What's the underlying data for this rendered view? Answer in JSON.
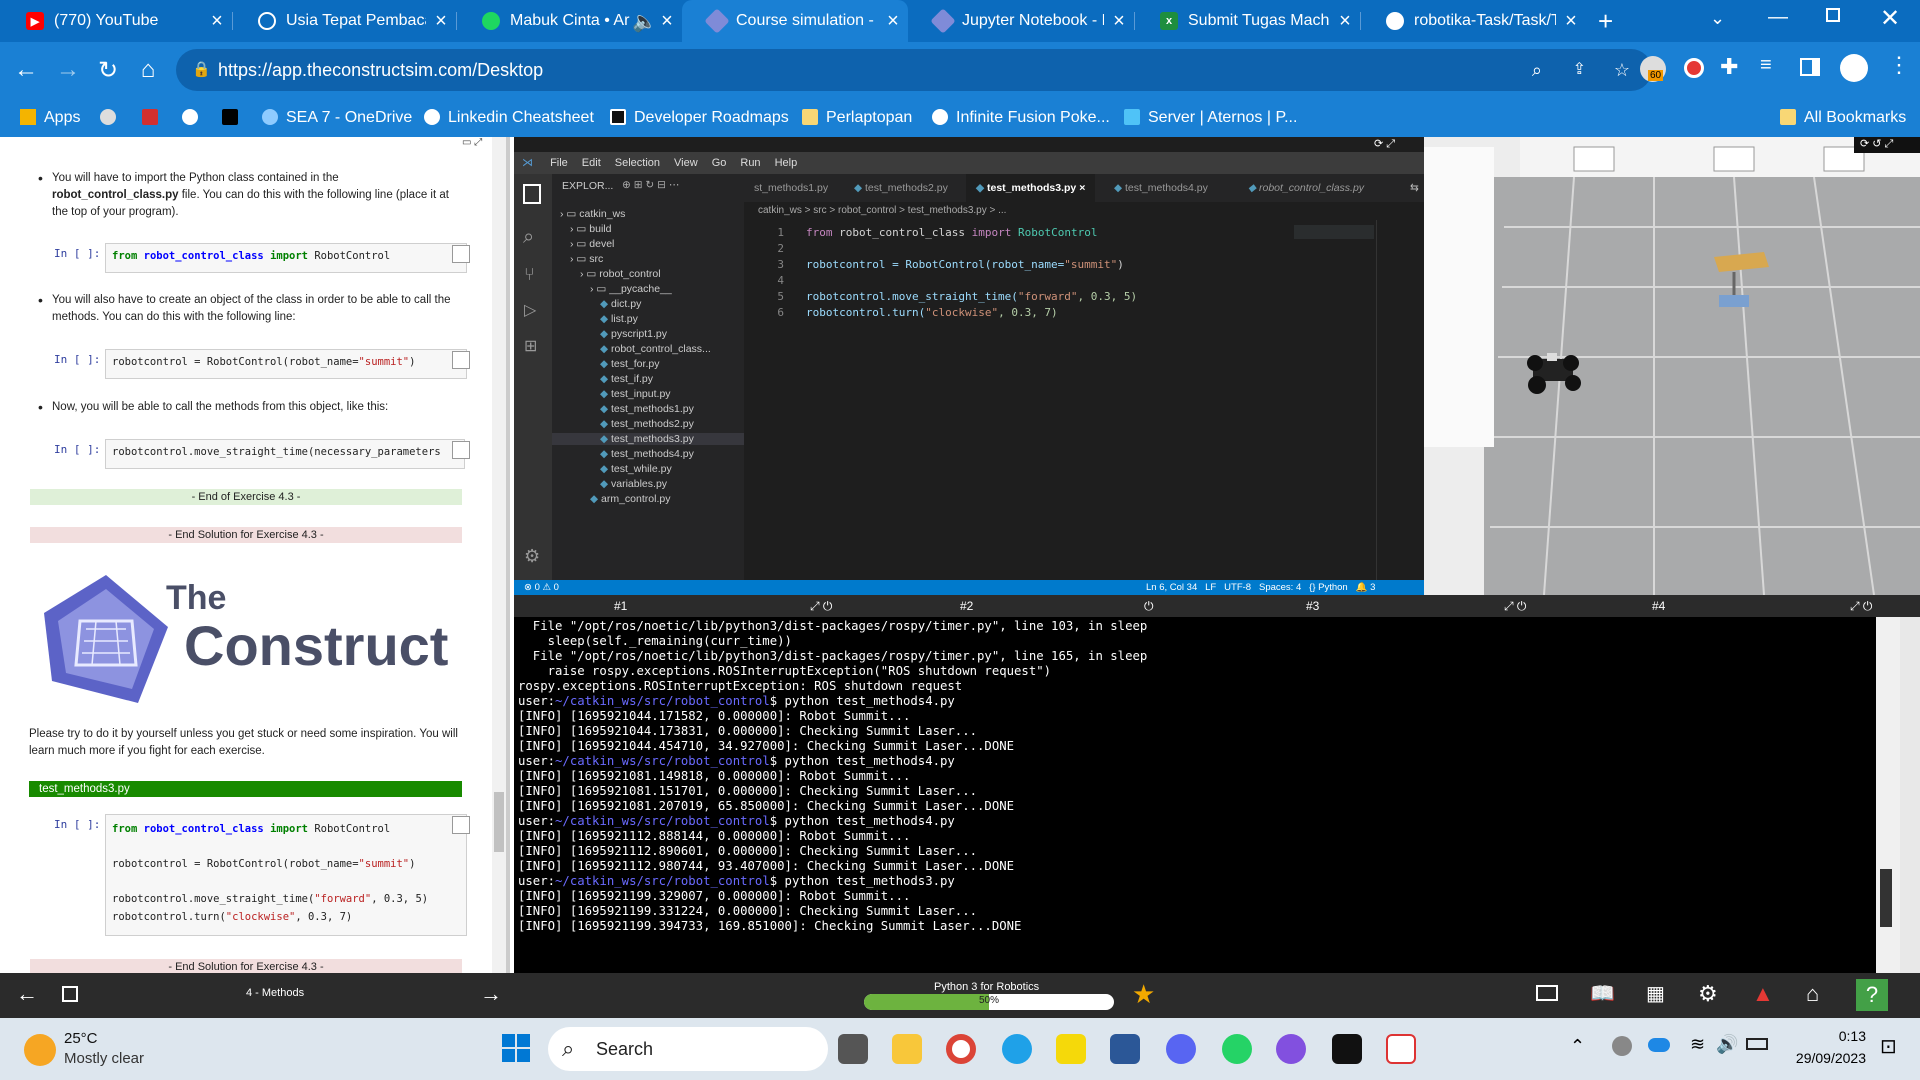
{
  "tabs": [
    {
      "title": "(770) YouTube",
      "icon": "youtube-icon",
      "color": "#ff0000"
    },
    {
      "title": "Usia Tepat Pembaca R",
      "icon": "openai-icon",
      "color": "#ffffff"
    },
    {
      "title": "Mabuk Cinta • Ar",
      "icon": "spotify-icon",
      "color": "#1ed760"
    },
    {
      "title": "Course simulation - P",
      "icon": "theconstruct-icon",
      "color": "#7f8bd8"
    },
    {
      "title": "Jupyter Notebook - P",
      "icon": "theconstruct-icon",
      "color": "#7f8bd8"
    },
    {
      "title": "Submit Tugas Machin",
      "icon": "sheets-icon",
      "color": "#1e8e3e"
    },
    {
      "title": "robotika-Task/Task/Ta",
      "icon": "github-icon",
      "color": "#ffffff"
    }
  ],
  "address": {
    "url": "https://app.theconstructsim.com/Desktop",
    "badge": "60"
  },
  "bookmarks": [
    "Apps",
    "SEA 7 - OneDrive",
    "Linkedin Cheatsheet",
    "Developer Roadmaps",
    "Perlaptopan",
    "Infinite Fusion Poke...",
    "Server | Aternos | P...",
    "All Bookmarks"
  ],
  "notebook": {
    "bullet1_a": "You will have to import the Python class contained in the",
    "bullet1_b": "robot_control_class.py",
    "bullet1_c": " file. You can do this with the following line (place it at the top of your program).",
    "prompt": "In [ ]:",
    "code1_from": "from",
    "code1_mod": "robot_control_class",
    "code1_import": "import",
    "code1_cls": "RobotControl",
    "bullet2": "You will also have to create an object of the class in order to be able to call the methods. You can do this with the following line:",
    "code2_a": "robotcontrol = RobotControl(robot_name=",
    "code2_str": "\"summit\"",
    "code2_b": ")",
    "bullet3": "Now, you will be able to call the methods from this object, like this:",
    "code3": "robotcontrol.move_straight_time(necessary_parameters",
    "end_ex": "- End of Exercise 4.3 -",
    "end_sol": "- End Solution for Exercise 4.3 -",
    "logo_the": "The",
    "logo_construct": "Construct",
    "tip": "Please try to do it by yourself unless you get stuck or need some inspiration. You will learn much more if you fight for each exercise.",
    "file_label": "test_methods3.py",
    "code4_l3a": "robotcontrol.move_straight_time(",
    "code4_l3s": "\"forward\"",
    "code4_l3b": ", 0.3, 5)",
    "code4_l4a": "robotcontrol.turn(",
    "code4_l4s": "\"clockwise\"",
    "code4_l4b": ", 0.3, 7)",
    "end_sol2": "- End Solution for Exercise 4.3 -"
  },
  "vscode": {
    "menu": [
      "File",
      "Edit",
      "Selection",
      "View",
      "Go",
      "Run",
      "Help"
    ],
    "explorer_title": "EXPLOR...",
    "tree": [
      "catkin_ws",
      "build",
      "devel",
      "src",
      "robot_control",
      "__pycache__",
      "dict.py",
      "list.py",
      "pyscript1.py",
      "robot_control_class...",
      "test_for.py",
      "test_if.py",
      "test_input.py",
      "test_methods1.py",
      "test_methods2.py",
      "test_methods3.py",
      "test_methods4.py",
      "test_while.py",
      "variables.py",
      "arm_control.py"
    ],
    "editor_tabs": [
      "st_methods1.py",
      "test_methods2.py",
      "test_methods3.py",
      "test_methods4.py",
      "robot_control_class.py"
    ],
    "breadcrumb": "catkin_ws  >  src  >  robot_control  >  test_methods3.py  >  ...",
    "lines": [
      "1",
      "2",
      "3",
      "4",
      "5",
      "6"
    ],
    "status_left": "⊗ 0 ⚠ 0",
    "status_right": "Ln 6, Col 34   LF   UTF-8   Spaces: 4   {} Python   🔔 3"
  },
  "terminal": {
    "tabs": [
      "#1",
      "#2",
      "#3",
      "#4"
    ],
    "lines": [
      "  File \"/opt/ros/noetic/lib/python3/dist-packages/rospy/timer.py\", line 103, in sleep",
      "    sleep(self._remaining(curr_time))",
      "  File \"/opt/ros/noetic/lib/python3/dist-packages/rospy/timer.py\", line 165, in sleep",
      "    raise rospy.exceptions.ROSInterruptException(\"ROS shutdown request\")",
      "rospy.exceptions.ROSInterruptException: ROS shutdown request",
      "$user:~/catkin_ws/src/robot_control$ python test_methods4.py",
      "[INFO] [1695921044.171582, 0.000000]: Robot Summit...",
      "[INFO] [1695921044.173831, 0.000000]: Checking Summit Laser...",
      "[INFO] [1695921044.454710, 34.927000]: Checking Summit Laser...DONE",
      "$user:~/catkin_ws/src/robot_control$ python test_methods4.py",
      "[INFO] [1695921081.149818, 0.000000]: Robot Summit...",
      "[INFO] [1695921081.151701, 0.000000]: Checking Summit Laser...",
      "[INFO] [1695921081.207019, 65.850000]: Checking Summit Laser...DONE",
      "$user:~/catkin_ws/src/robot_control$ python test_methods4.py",
      "[INFO] [1695921112.888144, 0.000000]: Robot Summit...",
      "[INFO] [1695921112.890601, 0.000000]: Checking Summit Laser...",
      "[INFO] [1695921112.980744, 93.407000]: Checking Summit Laser...DONE",
      "$user:~/catkin_ws/src/robot_control$ python test_methods3.py",
      "[INFO] [1695921199.329007, 0.000000]: Robot Summit...",
      "[INFO] [1695921199.331224, 0.000000]: Checking Summit Laser...",
      "[INFO] [1695921199.394733, 169.851000]: Checking Summit Laser...DONE"
    ]
  },
  "appbar": {
    "unit": "4 - Methods",
    "course": "Python 3 for Robotics",
    "progress_label": "50%",
    "progress": 0.5
  },
  "taskbar": {
    "temp": "25°C",
    "weather": "Mostly clear",
    "search": "Search",
    "time": "0:13",
    "date": "29/09/2023"
  }
}
